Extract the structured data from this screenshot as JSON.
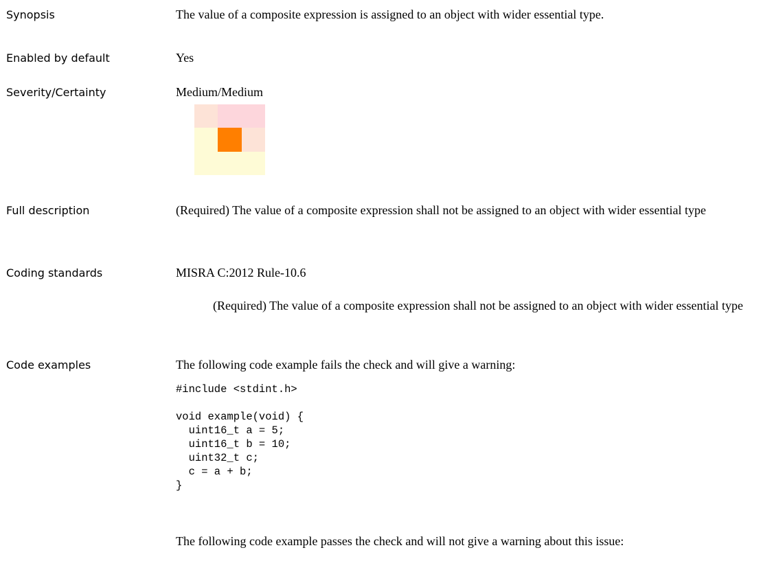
{
  "rows": {
    "synopsis": {
      "label": "Synopsis",
      "value": "The value of a composite expression is assigned to an object with wider essential type."
    },
    "enabled": {
      "label": "Enabled by default",
      "value": "Yes"
    },
    "severity": {
      "label": "Severity/Certainty",
      "value": "Medium/Medium",
      "matrix_colors": [
        [
          "#fde3d7",
          "#fdd6dc",
          "#fdd6dc"
        ],
        [
          "#fefbd6",
          "#ff7f00",
          "#fde3d7"
        ],
        [
          "#fefbd6",
          "#fefbd6",
          "#fefbd6"
        ]
      ]
    },
    "full_description": {
      "label": "Full description",
      "value": "(Required) The value of a composite expression shall not be assigned to an object with wider essential type"
    },
    "coding_standards": {
      "label": "Coding standards",
      "standard": "MISRA C:2012 Rule-10.6",
      "description": "(Required) The value of a composite expression shall not be assigned to an object with wider essential type"
    },
    "code_examples": {
      "label": "Code examples",
      "fail_intro": "The following code example fails the check and will give a warning:",
      "fail_code": "#include <stdint.h>\n\nvoid example(void) {\n  uint16_t a = 5;\n  uint16_t b = 10;\n  uint32_t c;\n  c = a + b;\n}",
      "pass_intro": "The following code example passes the check and will not give a warning about this issue:"
    }
  }
}
